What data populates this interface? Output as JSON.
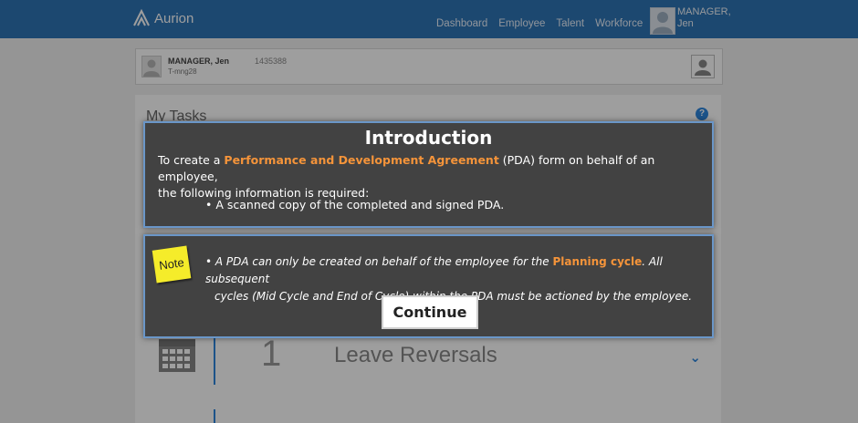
{
  "app": {
    "logo_text": "Aurion"
  },
  "nav": {
    "items": [
      "Dashboard",
      "Employee",
      "Talent",
      "Workforce"
    ]
  },
  "user": {
    "name_line1": "MANAGER,",
    "name_line2": "Jen"
  },
  "profile": {
    "name": "MANAGER, Jen",
    "id": "1435388",
    "code": "T-mng28"
  },
  "tasks": {
    "title": "My Tasks",
    "item": {
      "count": "1",
      "label": "Leave Reversals"
    }
  },
  "modal": {
    "title": "Introduction",
    "body_pre": "To create a ",
    "body_highlight": "Performance and Development Agreement",
    "body_post": " (PDA) form on behalf of an employee,",
    "body_line2": "the following information is required:",
    "bullet": "• A scanned copy of the completed and signed PDA.",
    "note_label": "Note",
    "note_pre": "• A PDA can only be created on behalf of the employee for the ",
    "note_highlight": "Planning cycle",
    "note_post": ". All subsequent",
    "note_line2": "cycles (Mid Cycle and End of Cycle) within the PDA must be actioned by the employee.",
    "continue_label": "Continue"
  },
  "colors": {
    "accent": "#2e74b5",
    "highlight": "#f5943a",
    "panel": "#424242",
    "note": "#f5ec2a"
  }
}
